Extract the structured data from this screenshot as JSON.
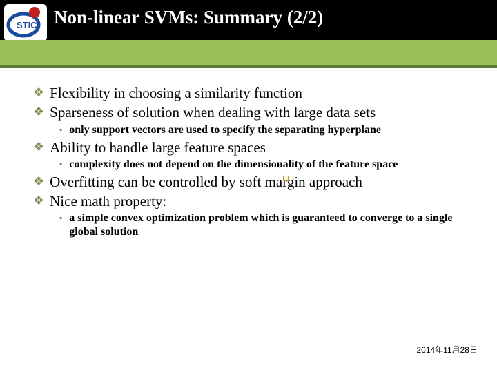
{
  "header": {
    "title": "Non-linear SVMs: Summary (2/2)"
  },
  "bullets": {
    "b1": "Flexibility in choosing a similarity function",
    "b2": "Sparseness of solution when dealing with large data sets",
    "b2_1": "only support vectors are used to specify the separating hyperplane",
    "b3": "Ability to handle large feature spaces",
    "b3_1": "complexity does not depend on the dimensionality of the feature space",
    "b4": "Overfitting can be controlled by soft margin approach",
    "b5": "Nice math property:",
    "b5_1": "a simple convex optimization problem which is guaranteed to converge to a single global solution"
  },
  "footer": {
    "date": "2014年11月28日"
  }
}
